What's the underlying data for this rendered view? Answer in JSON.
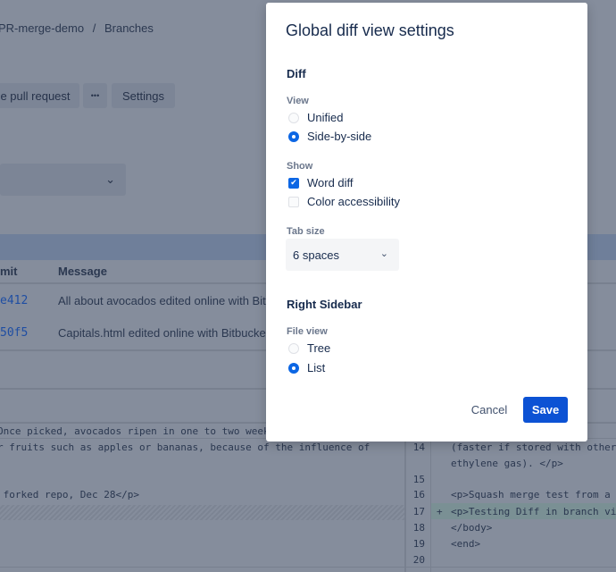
{
  "background": {
    "breadcrumb": {
      "repo": "PR-merge-demo",
      "separator": "/",
      "current": "Branches"
    },
    "toolbar": {
      "create_pr": "e pull request",
      "more": "•••",
      "settings": "Settings"
    },
    "dropdown_chevron": "⌄",
    "table": {
      "headers": [
        "mit",
        "Message"
      ],
      "rows": [
        {
          "hash": "e412",
          "message": "All about avocados edited online with Bit"
        },
        {
          "hash": "50f5",
          "message": "Capitals.html edited online with Bitbucke"
        }
      ]
    },
    "diff": {
      "left_header": "Once picked, avocados ripen in one to two weeks",
      "left_lines": [
        "r fruits such as apples or bananas, because of the influence of",
        " forked repo, Dec 28</p>"
      ],
      "right_lines": [
        {
          "num": "14",
          "marker": "",
          "text": "(faster if stored with other"
        },
        {
          "num": "",
          "marker": "",
          "text": "ethylene gas). </p>"
        },
        {
          "num": "15",
          "marker": "",
          "text": ""
        },
        {
          "num": "16",
          "marker": "",
          "text": "<p>Squash merge test from a f"
        },
        {
          "num": "17",
          "marker": "+",
          "text": "<p>Testing Diff in branch vie"
        },
        {
          "num": "18",
          "marker": "",
          "text": "</body>"
        },
        {
          "num": "19",
          "marker": "",
          "text": "<end>"
        },
        {
          "num": "20",
          "marker": "",
          "text": ""
        }
      ]
    }
  },
  "dialog": {
    "title": "Global diff view settings",
    "diff_section": "Diff",
    "view_label": "View",
    "view_options": [
      {
        "label": "Unified",
        "selected": false
      },
      {
        "label": "Side-by-side",
        "selected": true
      }
    ],
    "show_label": "Show",
    "show_options": [
      {
        "label": "Word diff",
        "checked": true
      },
      {
        "label": "Color accessibility",
        "checked": false
      }
    ],
    "tab_size_label": "Tab size",
    "tab_size_value": "6 spaces",
    "sidebar_section": "Right Sidebar",
    "file_view_label": "File view",
    "file_view_options": [
      {
        "label": "Tree",
        "selected": false
      },
      {
        "label": "List",
        "selected": true
      }
    ],
    "cancel": "Cancel",
    "save": "Save",
    "checkmark": "✔",
    "chevron": "⌄"
  },
  "colors": {
    "accent": "#0c52d4",
    "overlay": "#858d9c"
  }
}
